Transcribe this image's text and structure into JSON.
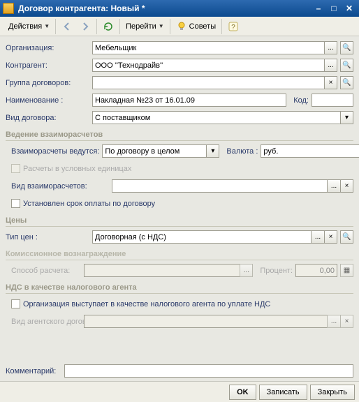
{
  "title": "Договор контрагента: Новый *",
  "toolbar": {
    "actions": "Действия",
    "go": "Перейти",
    "advice": "Советы"
  },
  "fields": {
    "org_label": "Организация:",
    "org_value": "Мебельщик",
    "counterparty_label": "Контрагент:",
    "counterparty_value": "ООО ''Технодрайв''",
    "contract_group_label": "Группа договоров:",
    "contract_group_value": "",
    "name_label": "Наименование :",
    "name_value": "Накладная №23 от 16.01.09",
    "code_label": "Код:",
    "code_value": "",
    "contract_type_label": "Вид договора:",
    "contract_type_value": "С поставщиком"
  },
  "section_settlements": "Ведение взаиморасчетов",
  "settlements": {
    "basis_label": "Взаиморасчеты ведутся:",
    "basis_value": "По договору в целом",
    "currency_label": "Валюта :",
    "currency_value": "руб.",
    "cu_calc_label": "Расчеты в условных единицах",
    "settlement_type_label": "Вид взаиморасчетов:",
    "settlement_type_value": "",
    "payment_term_label": "Установлен срок оплаты по договору"
  },
  "section_prices": "Цены",
  "prices": {
    "price_type_label": "Тип цен :",
    "price_type_value": "Договорная (с НДС)"
  },
  "section_commission": "Комиссионное вознаграждение",
  "commission": {
    "calc_method_label": "Способ расчета:",
    "calc_method_value": "",
    "percent_label": "Процент:",
    "percent_value": "0,00"
  },
  "section_tax_agent": "НДС в качестве налогового агента",
  "tax_agent": {
    "is_agent_label": "Организация выступает в качестве налогового агента по уплате НДС",
    "agent_contract_type_label": "Вид агентского договора:",
    "agent_contract_type_value": ""
  },
  "comment_label": "Комментарий:",
  "comment_value": "",
  "footer": {
    "ok": "OK",
    "save": "Записать",
    "close": "Закрыть"
  },
  "glyph": {
    "dots": "...",
    "search": "🔍",
    "clear": "×",
    "down": "▾",
    "calc": "▦"
  }
}
